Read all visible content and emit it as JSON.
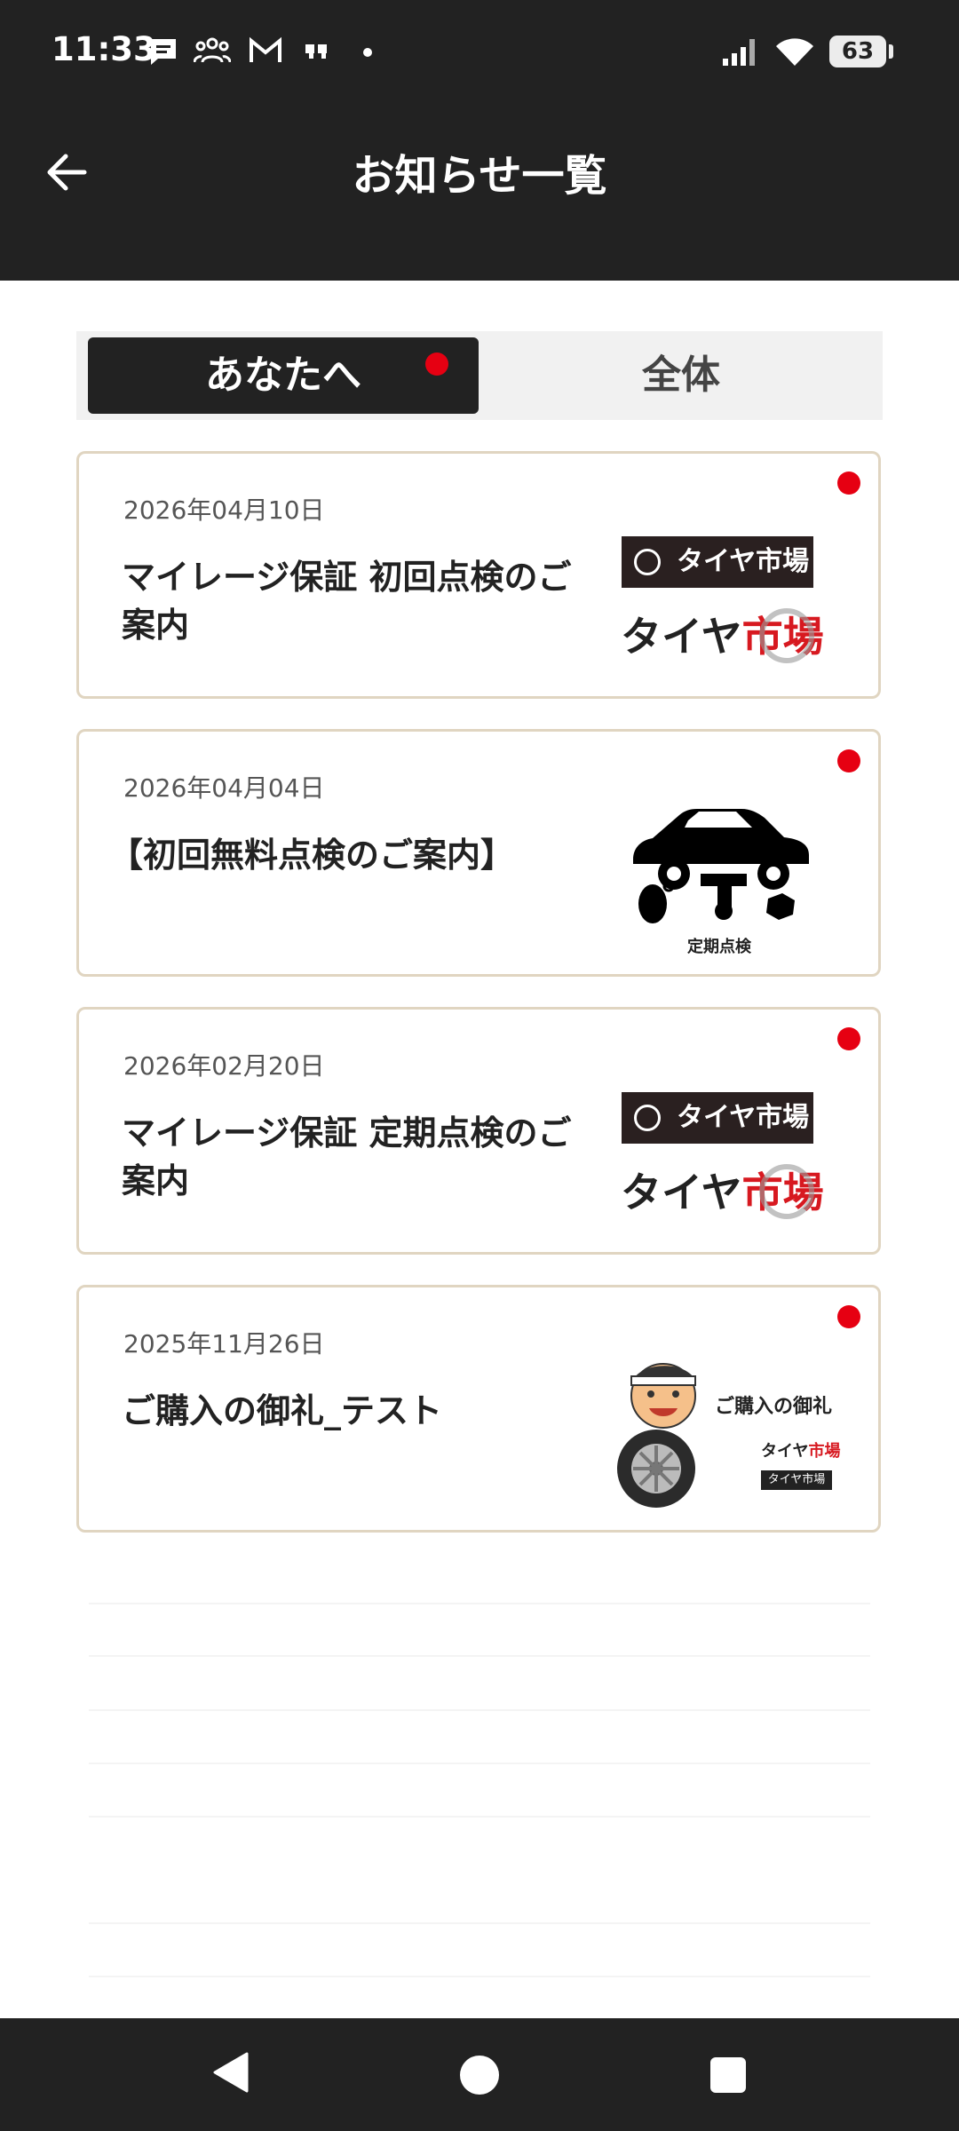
{
  "status_bar": {
    "time": "11:33",
    "battery": "63"
  },
  "header": {
    "title": "お知らせ一覧"
  },
  "tabs": {
    "active": "あなたへ",
    "other": "全体"
  },
  "notices": [
    {
      "date": "2026年04月10日",
      "title": "マイレージ保証 初回点検のご案内",
      "thumb": "tire-ichiba-logo"
    },
    {
      "date": "2026年04月04日",
      "title": "【初回無料点検のご案内】",
      "thumb": "periodic-inspection-car",
      "thumb_caption": "定期点検"
    },
    {
      "date": "2026年02月20日",
      "title": "マイレージ保証 定期点検のご案内",
      "thumb": "tire-ichiba-logo"
    },
    {
      "date": "2025年11月26日",
      "title": "ご購入の御礼_テスト",
      "thumb": "thank-you-mascot",
      "thumb_caption": "ご購入の御礼"
    }
  ],
  "logo_text": {
    "top": "タイヤ市場",
    "bottom_black": "タイヤ",
    "bottom_red": "市場"
  },
  "colors": {
    "header_bg": "#222222",
    "unread_dot": "#e60012",
    "card_border": "#e0d5c1"
  }
}
